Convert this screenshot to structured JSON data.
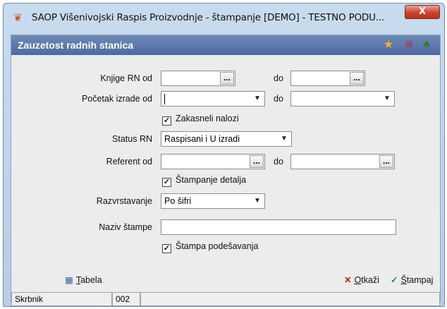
{
  "window": {
    "title": "SAOP  Višenivojski Raspis Proizvodnje - štampanje  [DEMO] - TESTNO PODU...",
    "close_label": "X"
  },
  "header": {
    "title": "Zauzetost radnih stanica",
    "icons": [
      "star-icon",
      "pdf-icon",
      "book-icon"
    ]
  },
  "form": {
    "knjige_rn": {
      "label": "Knjige RN od",
      "from_value": "",
      "to_label": "do",
      "to_value": ""
    },
    "pocetak_izrade": {
      "label": "Početak izrade od",
      "from_value": "",
      "to_label": "do",
      "to_value": ""
    },
    "zakasneli_nalozi": {
      "label": "Zakasneli nalozi",
      "checked": true
    },
    "status_rn": {
      "label": "Status RN",
      "value": "Raspisani i U izradi"
    },
    "referent": {
      "label": "Referent od",
      "from_value": "",
      "to_label": "do",
      "to_value": ""
    },
    "stampanje_detalja": {
      "label": "Štampanje detalja",
      "checked": true
    },
    "razvrstavanje": {
      "label": "Razvrstavanje",
      "value": "Po šifri"
    },
    "naziv_stampe": {
      "label": "Naziv štampe",
      "value": ""
    },
    "stampa_podesavanja": {
      "label": "Štampa podešavanja",
      "checked": true
    }
  },
  "buttons": {
    "tabela": {
      "first": "T",
      "rest": "abela"
    },
    "otkazi": {
      "first": "O",
      "rest": "tkaži"
    },
    "stampaj": {
      "first": "Š",
      "rest": "tampaj"
    },
    "ellipsis": "..."
  },
  "statusbar": {
    "user": "Skrbnik",
    "code": "002"
  }
}
